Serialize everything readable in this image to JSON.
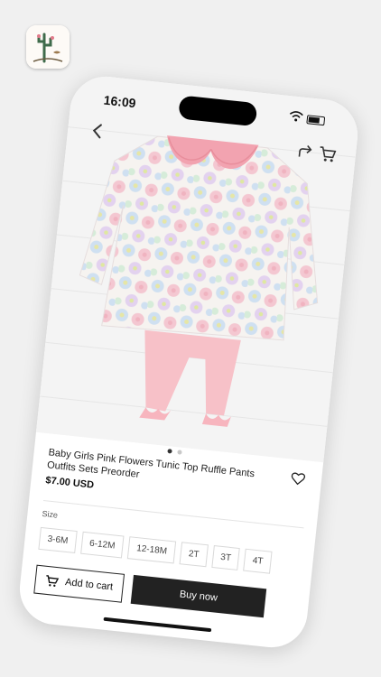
{
  "status_bar": {
    "time": "16:09"
  },
  "product": {
    "title": "Baby Girls Pink Flowers Tunic Top Ruffle Pants Outfits Sets Preorder",
    "price": "$7.00 USD"
  },
  "carousel": {
    "total": 2,
    "active_index": 0
  },
  "size_section": {
    "label": "Size",
    "options": [
      "3-6M",
      "6-12M",
      "12-18M",
      "2T",
      "3T",
      "4T"
    ]
  },
  "actions": {
    "add_to_cart_label": "Add to cart",
    "buy_now_label": "Buy now"
  },
  "icons": {
    "back": "chevron-left-icon",
    "share": "share-icon",
    "cart": "cart-icon",
    "favorite": "heart-icon",
    "add_to_cart": "cart-icon"
  },
  "colors": {
    "buy_now_bg": "#222222",
    "collar_pink": "#f2a3b0",
    "pants_pink": "#f7c1c8",
    "page_bg": "#f0f0f0"
  }
}
